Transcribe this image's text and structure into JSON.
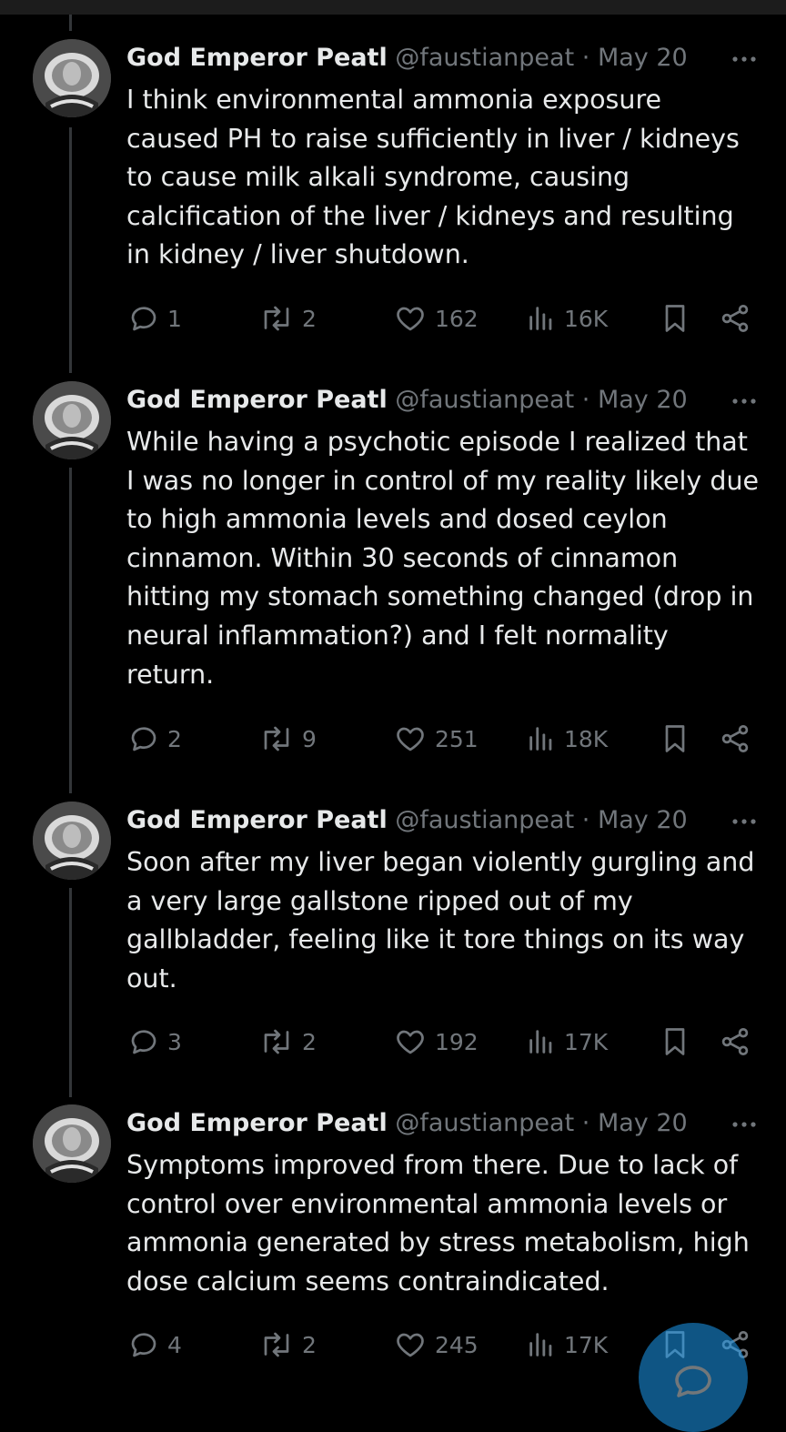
{
  "colors": {
    "background": "#000000",
    "text_primary": "#e7e9ea",
    "text_secondary": "#71767b",
    "thread_line": "#333639",
    "accent": "#1d9bf0"
  },
  "icons": {
    "more": "more-horizontal-icon",
    "reply": "reply-bubble-icon",
    "retweet": "retweet-icon",
    "like": "heart-icon",
    "views": "bar-chart-icon",
    "bookmark": "bookmark-icon",
    "share": "share-icon",
    "compose": "compose-reply-icon"
  },
  "tweets": [
    {
      "author_name": "God Emperor Peatl",
      "handle": "@faustianpeat",
      "separator": "·",
      "date": "May 20",
      "text": "I think environmental ammonia exposure\ncaused PH to raise sufficiently in liver / kidneys\nto cause milk alkali syndrome, causing\ncalcification of the liver / kidneys and resulting\nin kidney / liver shutdown.",
      "replies": "1",
      "retweets": "2",
      "likes": "162",
      "views": "16K"
    },
    {
      "author_name": "God Emperor Peatl",
      "handle": "@faustianpeat",
      "separator": "·",
      "date": "May 20",
      "text": "While having a psychotic episode I realized that\nI was no longer in control of my reality likely due\nto high ammonia levels and dosed ceylon\ncinnamon. Within 30 seconds of cinnamon\nhitting my stomach something changed (drop in\nneural inflammation?) and I felt normality\nreturn.",
      "replies": "2",
      "retweets": "9",
      "likes": "251",
      "views": "18K"
    },
    {
      "author_name": "God Emperor Peatl",
      "handle": "@faustianpeat",
      "separator": "·",
      "date": "May 20",
      "text": "Soon after my liver began violently gurgling and\na very large gallstone ripped out of my\ngallbladder, feeling like it tore things on its way\nout.",
      "replies": "3",
      "retweets": "2",
      "likes": "192",
      "views": "17K"
    },
    {
      "author_name": "God Emperor Peatl",
      "handle": "@faustianpeat",
      "separator": "·",
      "date": "May 20",
      "text": "Symptoms improved from there. Due to lack of\ncontrol over environmental ammonia levels or\nammonia generated by stress metabolism, high\ndose calcium seems contraindicated.",
      "replies": "4",
      "retweets": "2",
      "likes": "245",
      "views": "17K"
    }
  ]
}
